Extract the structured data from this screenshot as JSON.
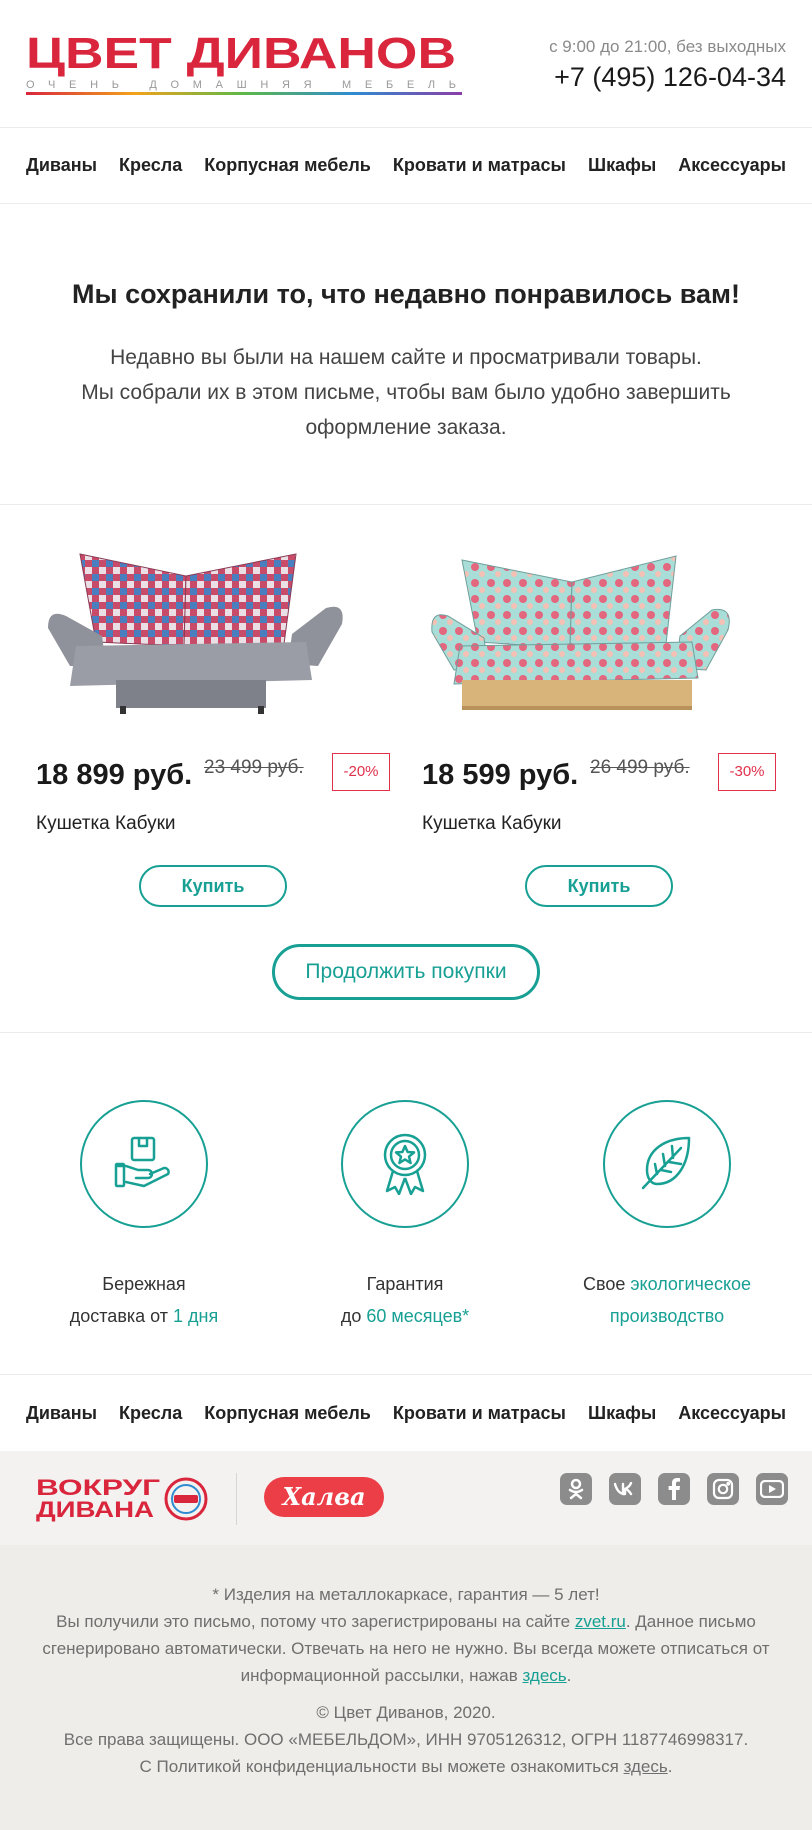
{
  "header": {
    "logo_text": "ЦВЕТ ДИВАНОВ",
    "logo_tagline": "ОЧЕНЬ ДОМАШНЯЯ МЕБЕЛЬ",
    "hours": "с 9:00 до 21:00, без выходных",
    "phone": "+7 (495) 126-04-34"
  },
  "nav": [
    "Диваны",
    "Кресла",
    "Корпусная мебель",
    "Кровати и матрасы",
    "Шкафы",
    "Аксессуары"
  ],
  "intro": {
    "title": "Мы сохранили то, что недавно понравилось вам!",
    "line1": "Недавно вы были на нашем сайте и просматривали товары.",
    "line2": "Мы собрали их в этом письме, чтобы вам было удобно завершить",
    "line3": "оформление заказа."
  },
  "products": [
    {
      "price": "18 899 руб.",
      "old_price": "23 499 руб.",
      "discount": "-20%",
      "name": "Кушетка Кабуки",
      "buy_label": "Купить"
    },
    {
      "price": "18 599 руб.",
      "old_price": "26 499 руб.",
      "discount": "-30%",
      "name": "Кушетка Кабуки",
      "buy_label": "Купить"
    }
  ],
  "continue_label": "Продолжить покупки",
  "benefits": [
    {
      "text1": "Бережная",
      "text2": "доставка от ",
      "accent": "1 дня",
      "icon": "delivery-box-hand-icon"
    },
    {
      "text1": "Гарантия",
      "text2": "до ",
      "accent": "60 месяцев*",
      "icon": "warranty-badge-icon"
    },
    {
      "text1": "Свое ",
      "accent1": "экологическое",
      "accent2": "производство",
      "icon": "leaf-icon"
    }
  ],
  "partners": {
    "vokrug_line1": "ВОКРУГ",
    "vokrug_line2": "ДИВАНА",
    "halva": "Халва"
  },
  "socials": [
    "odnoklassniki-icon",
    "vk-icon",
    "facebook-icon",
    "instagram-icon",
    "youtube-icon"
  ],
  "footer": {
    "note": "* Изделия на металлокаркасе, гарантия — 5 лет!",
    "p1_a": "Вы получили это письмо, потому что зарегистрированы на сайте ",
    "p1_link": "zvet.ru",
    "p1_b": ". Данное письмо",
    "p2": "сгенерировано автоматически. Отвечать на него не нужно. Вы всегда можете отписаться от",
    "p3_a": "информационной рассылки, нажав ",
    "p3_link": "здесь",
    "p3_b": ".",
    "copyright": "© Цвет Диванов, 2020.",
    "rights": "Все права защищены. ООО «МЕБЕЛЬДОМ», ИНН 9705126312, ОГРН 1187746998317.",
    "privacy_a": "С Политикой конфиденциальности вы можете ознакомиться ",
    "privacy_link": "здесь",
    "privacy_b": "."
  },
  "colors": {
    "accent": "#17a093",
    "brand_red": "#e0314b",
    "halva": "#ec3e47"
  }
}
